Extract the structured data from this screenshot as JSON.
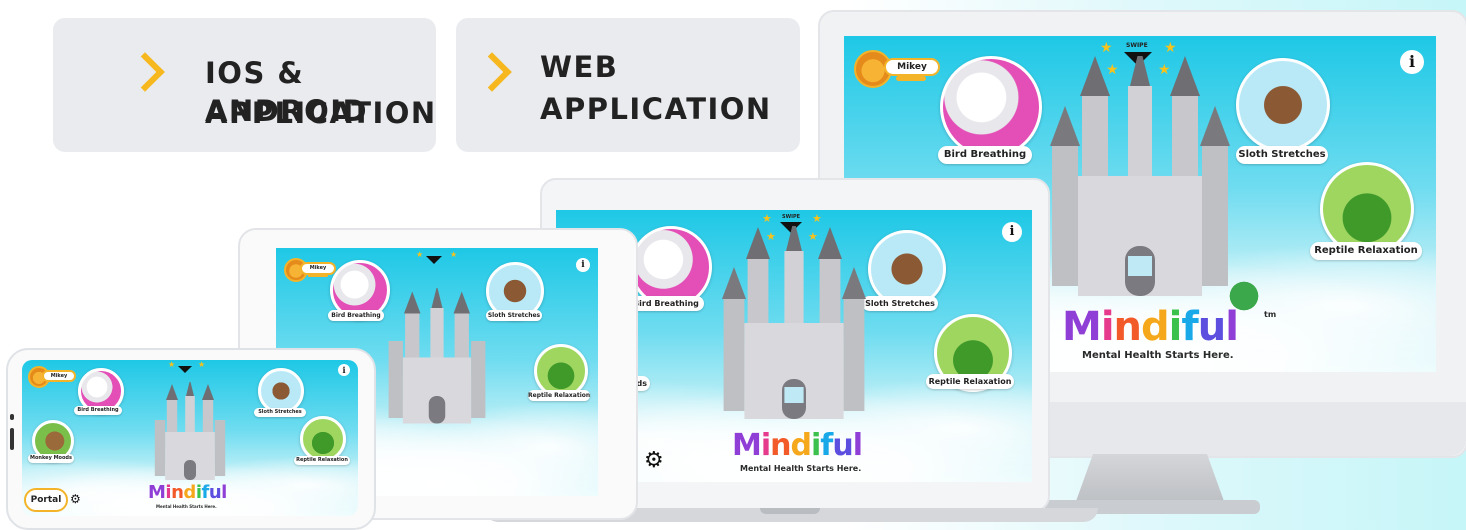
{
  "badges": [
    {
      "line1": "IOS & ANDROID",
      "line2": "APPLICATION"
    },
    {
      "line1": "WEB",
      "line2": "APPLICATION"
    }
  ],
  "app": {
    "swipe_label": "SWIPE",
    "user_name": "Mikey",
    "info_glyph": "i",
    "activities": {
      "bird": "Bird Breathing",
      "sloth": "Sloth Stretches",
      "reptile": "Reptile Relaxation",
      "monkey": "Monkey Moods",
      "monkey_partial": "ods"
    },
    "logo_letters": [
      "M",
      "i",
      "n",
      "d",
      "f",
      "u",
      "l"
    ],
    "logo_tm": "tm",
    "tagline": "Mental Health Starts Here.",
    "portal_label": "Portal",
    "colors": {
      "sky": "#1ec8e6",
      "badge_bg": "#e9ebef",
      "accent_chevron": "#f6b81e",
      "logo": [
        "#8f3fd6",
        "#e63a8c",
        "#f25a2a",
        "#f6a81c",
        "#3cc14c",
        "#19a9e8",
        "#5c4fe0"
      ]
    },
    "icons": [
      "chevron-right-icon",
      "lion-avatar-icon",
      "key-icon",
      "star-icon",
      "chevron-down-icon",
      "info-icon",
      "gear-icon"
    ]
  }
}
